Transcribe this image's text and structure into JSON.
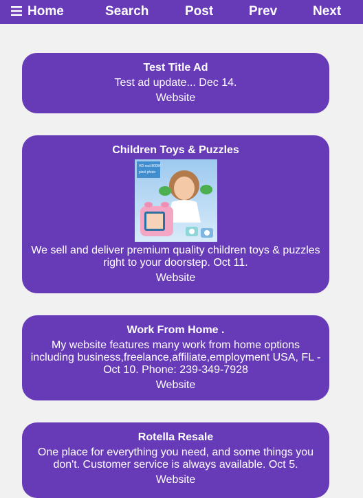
{
  "nav": {
    "home_label": "Home",
    "search_label": "Search",
    "post_label": "Post",
    "prev_label": "Prev",
    "next_label": "Next",
    "background_color": "#673ab7",
    "menu_icon": "hamburger-menu-icon"
  },
  "ads": [
    {
      "title": "Test Title Ad",
      "description": "Test ad update... Dec 14.",
      "link_label": "Website"
    },
    {
      "title": "Children Toys & Puzzles",
      "image_caption": "HD real 800W pixel photo",
      "description": "We sell and deliver premium quality children toys & puzzles right to your doorstep. Oct 11.",
      "link_label": "Website"
    },
    {
      "title": "Work From Home .",
      "description": "My website features many work from home options including business,freelance,affiliate,employment USA, FL - Oct 10. Phone: 239-349-7928",
      "link_label": "Website"
    },
    {
      "title": "Rotella Resale",
      "description": "One place for everything you need, and some things you don't. Customer service is always available. Oct 5.",
      "link_label": "Website"
    }
  ],
  "colors": {
    "card_background": "#673ab7",
    "page_background": "#f1f1f1",
    "text": "#ffffff"
  }
}
